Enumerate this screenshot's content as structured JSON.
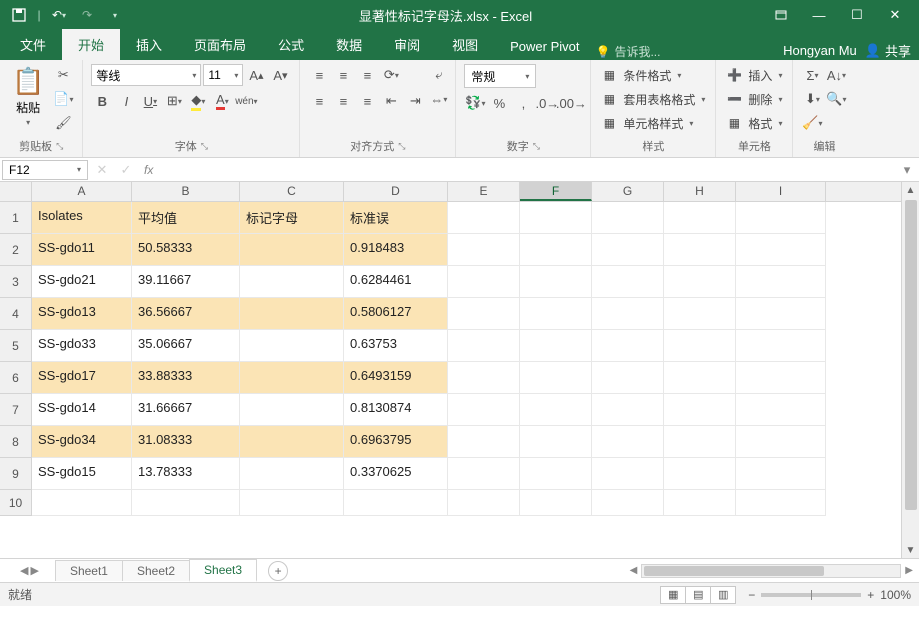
{
  "app": {
    "title": "显著性标记字母法.xlsx - Excel"
  },
  "qat": {
    "save": "保存",
    "undo": "撤消",
    "redo": "恢复"
  },
  "tabs": {
    "file": "文件",
    "home": "开始",
    "insert": "插入",
    "layout": "页面布局",
    "formulas": "公式",
    "data": "数据",
    "review": "审阅",
    "view": "视图",
    "powerpivot": "Power Pivot",
    "tellme": "告诉我...",
    "user": "Hongyan Mu",
    "share": "共享"
  },
  "ribbon": {
    "clipboard": {
      "paste": "粘贴",
      "label": "剪贴板"
    },
    "font": {
      "name": "等线",
      "size": "11",
      "label": "字体"
    },
    "alignment": {
      "label": "对齐方式"
    },
    "number": {
      "format": "常规",
      "label": "数字"
    },
    "styles": {
      "cond": "条件格式",
      "table": "套用表格格式",
      "cell": "单元格样式",
      "label": "样式"
    },
    "cells": {
      "insert": "插入",
      "delete": "删除",
      "format": "格式",
      "label": "单元格"
    },
    "editing": {
      "label": "编辑"
    }
  },
  "fbar": {
    "name": "F12",
    "formula": ""
  },
  "cols": {
    "A": 100,
    "B": 108,
    "C": 104,
    "D": 104,
    "E": 72,
    "F": 72,
    "G": 72,
    "H": 72,
    "I": 72
  },
  "headers": {
    "A": "Isolates",
    "B": "平均值",
    "C": "标记字母",
    "D": "标准误"
  },
  "rows": [
    {
      "A": "SS-gdo11",
      "B": "50.58333",
      "D": "0.918483"
    },
    {
      "A": "SS-gdo21",
      "B": "39.11667",
      "D": "0.6284461"
    },
    {
      "A": "SS-gdo13",
      "B": "36.56667",
      "D": "0.5806127"
    },
    {
      "A": "SS-gdo33",
      "B": "35.06667",
      "D": "0.63753"
    },
    {
      "A": "SS-gdo17",
      "B": "33.88333",
      "D": "0.6493159"
    },
    {
      "A": "SS-gdo14",
      "B": "31.66667",
      "D": "0.8130874"
    },
    {
      "A": "SS-gdo34",
      "B": "31.08333",
      "D": "0.6963795"
    },
    {
      "A": "SS-gdo15",
      "B": "13.78333",
      "D": "0.3370625"
    }
  ],
  "sheets": {
    "s1": "Sheet1",
    "s2": "Sheet2",
    "s3": "Sheet3"
  },
  "status": {
    "ready": "就绪",
    "zoom": "100%"
  }
}
